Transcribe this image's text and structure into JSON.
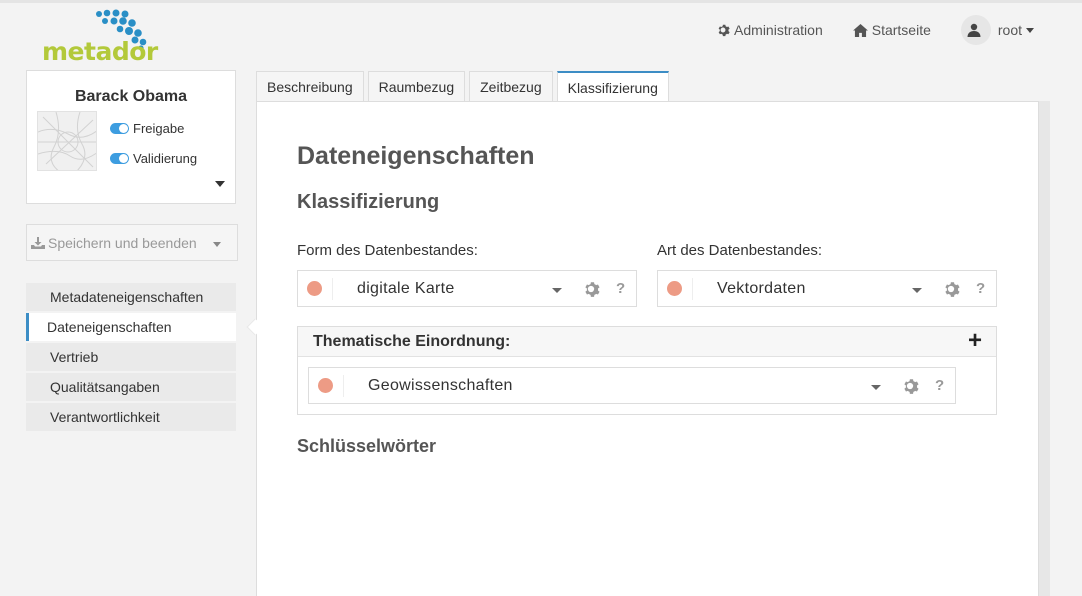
{
  "header": {
    "logo_text": "metador",
    "nav": {
      "admin_label": "Administration",
      "home_label": "Startseite",
      "user_label": "root"
    }
  },
  "sidebar": {
    "profile": {
      "name": "Barack Obama",
      "toggles": [
        {
          "label": "Freigabe",
          "on": true
        },
        {
          "label": "Validierung",
          "on": true
        }
      ]
    },
    "save_button": "Speichern und beenden",
    "items": [
      {
        "label": "Metadateneigenschaften",
        "active": false
      },
      {
        "label": "Dateneigenschaften",
        "active": true
      },
      {
        "label": "Vertrieb",
        "active": false
      },
      {
        "label": "Qualitätsangaben",
        "active": false
      },
      {
        "label": "Verantwortlichkeit",
        "active": false
      }
    ]
  },
  "tabs": [
    {
      "label": "Beschreibung",
      "active": false
    },
    {
      "label": "Raumbezug",
      "active": false
    },
    {
      "label": "Zeitbezug",
      "active": false
    },
    {
      "label": "Klassifizierung",
      "active": true
    }
  ],
  "main": {
    "title": "Dateneigenschaften",
    "section_title": "Klassifizierung",
    "form_field": {
      "label": "Form des Datenbestandes:",
      "value": "digitale Karte",
      "help": "?"
    },
    "art_field": {
      "label": "Art des Datenbestandes:",
      "value": "Vektordaten",
      "help": "?"
    },
    "thematic": {
      "title": "Thematische Einordnung:",
      "add_symbol": "+",
      "value": "Geowissenschaften",
      "help": "?"
    },
    "keywords_title": "Schlüsselwörter"
  },
  "colors": {
    "accent": "#3c8dc5",
    "status_dot": "#ed9b85",
    "logo_green": "#b3c93a",
    "logo_blue": "#2a8fc6"
  }
}
